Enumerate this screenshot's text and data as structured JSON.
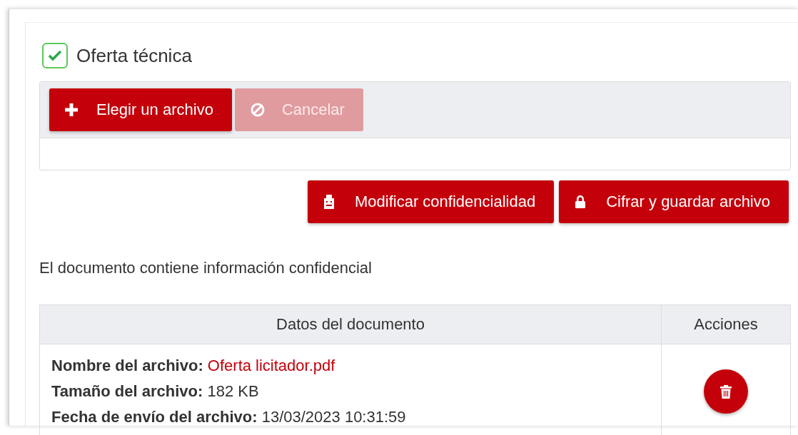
{
  "section": {
    "title": "Oferta técnica",
    "checked": true
  },
  "upload_toolbar": [
    {
      "label": "Elegir un archivo",
      "kind": "add",
      "disabled": false
    },
    {
      "label": "Cancelar",
      "kind": "cancel",
      "disabled": true
    }
  ],
  "actions": [
    {
      "label": "Modificar confidencialidad",
      "kind": "confidentiality",
      "disabled": false
    },
    {
      "label": "Cifrar y guardar archivo",
      "kind": "encrypt",
      "disabled": false
    }
  ],
  "notice": "El documento contiene información confidencial",
  "table": {
    "columns": [
      "Datos del documento",
      "Acciones"
    ],
    "rows": [
      {
        "details": [
          {
            "label": "Nombre del archivo:",
            "value": "Oferta licitador.pdf",
            "kind": "link"
          },
          {
            "label": "Tamaño del archivo:",
            "value": "182 KB",
            "kind": "text"
          },
          {
            "label": "Fecha de envío del archivo:",
            "value": "13/03/2023 10:31:59",
            "kind": "text"
          }
        ]
      }
    ]
  }
}
